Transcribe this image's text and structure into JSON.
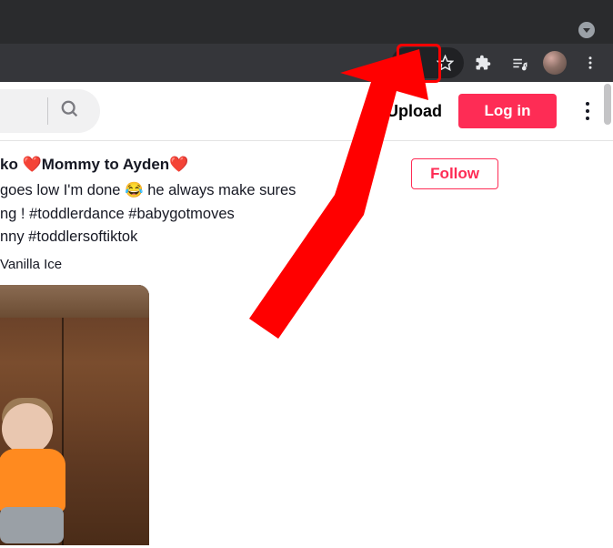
{
  "chrome": {
    "download_icon": "download",
    "star_icon": "star",
    "extensions_icon": "puzzle",
    "media_icon": "media-control",
    "profile_icon": "user-avatar",
    "menu_icon": "chrome-menu"
  },
  "app": {
    "search_placeholder": "",
    "upload_label": "Upload",
    "login_label": "Log in",
    "more_label": ""
  },
  "post": {
    "display_name_partial": "ko",
    "bio": "Mommy to Ayden",
    "heart_emoji": "❤️",
    "caption_line1": "goes low I'm done 😂 he always make sures",
    "caption_line2": "ng ! #toddlerdance #babygotmoves",
    "caption_line3": "nny #toddlersoftiktok",
    "music": "Vanilla Ice",
    "follow_label": "Follow"
  },
  "annotation": {
    "highlight_target": "download-icon"
  }
}
